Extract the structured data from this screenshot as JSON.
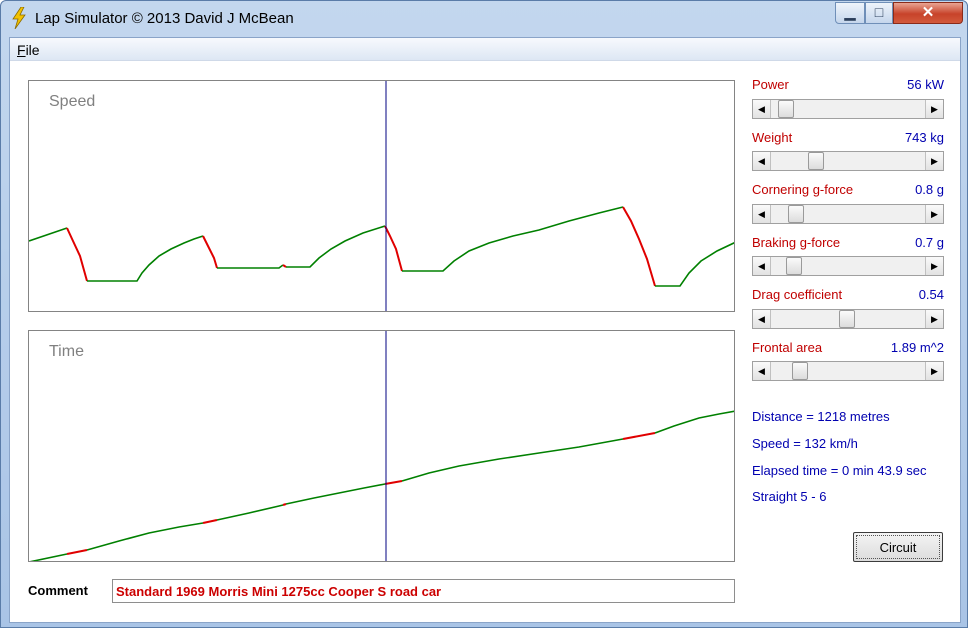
{
  "window": {
    "title": "Lap Simulator   © 2013 David J McBean",
    "min_glyph": "▁",
    "max_glyph": "□",
    "close_glyph": "✕"
  },
  "menu": {
    "file_mnemonic": "F",
    "file_rest": "ile"
  },
  "graphs": {
    "speed_label": "Speed",
    "time_label": "Time"
  },
  "params": [
    {
      "label": "Power",
      "value": "56 kW",
      "level": 0.05
    },
    {
      "label": "Weight",
      "value": "743 kg",
      "level": 0.27
    },
    {
      "label": "Cornering g-force",
      "value": "0.8 g",
      "level": 0.12
    },
    {
      "label": "Braking g-force",
      "value": "0.7 g",
      "level": 0.11
    },
    {
      "label": "Drag coefficient",
      "value": "0.54",
      "level": 0.49
    },
    {
      "label": "Frontal area",
      "value": "1.89 m^2",
      "level": 0.15
    }
  ],
  "info": {
    "distance": "Distance = 1218 metres",
    "speed": "Speed = 132 km/h",
    "elapsed": "Elapsed time = 0 min 43.9 sec",
    "segment": "Straight 5 - 6"
  },
  "circuit_button": "Circuit",
  "comment": {
    "label": "Comment",
    "value": "Standard 1969 Morris Mini 1275cc Cooper S road car"
  },
  "colors": {
    "accel": "#008000",
    "brake": "#e00000",
    "cursor": "#000080",
    "label_red": "#c00000",
    "value_blue": "#0000b0"
  },
  "arrows": {
    "left": "◀",
    "right": "▶"
  }
}
